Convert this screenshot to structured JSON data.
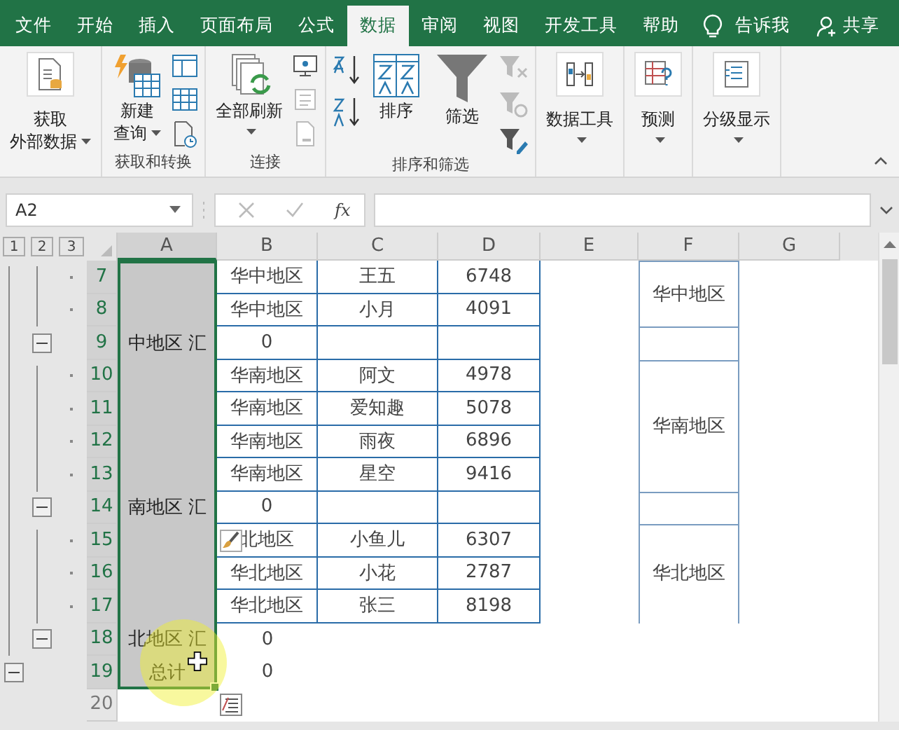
{
  "tabs": [
    {
      "label": "文件",
      "selected": false
    },
    {
      "label": "开始",
      "selected": false
    },
    {
      "label": "插入",
      "selected": false
    },
    {
      "label": "页面布局",
      "selected": false
    },
    {
      "label": "公式",
      "selected": false
    },
    {
      "label": "数据",
      "selected": true
    },
    {
      "label": "审阅",
      "selected": false
    },
    {
      "label": "视图",
      "selected": false
    },
    {
      "label": "开发工具",
      "selected": false
    },
    {
      "label": "帮助",
      "selected": false
    }
  ],
  "tell_me": "告诉我",
  "share": "共享",
  "ribbon": [
    {
      "kind": "get-data",
      "buttons": [
        {
          "lines": [
            "获取",
            "外部数据"
          ],
          "dropdown": true
        }
      ]
    },
    {
      "kind": "query",
      "label": "获取和转换",
      "buttons": [
        {
          "lines": [
            "新建",
            "查询"
          ],
          "dropdown": true
        }
      ]
    },
    {
      "kind": "connections",
      "label": "连接",
      "buttons": [
        {
          "lines": [
            "全部刷新"
          ],
          "dropdown": true
        }
      ]
    },
    {
      "kind": "sort-filter",
      "label": "排序和筛选",
      "buttons": [
        {
          "lines": [
            "排序"
          ],
          "dropdown": false
        },
        {
          "lines": [
            "筛选"
          ],
          "dropdown": false
        }
      ]
    },
    {
      "kind": "data-tools",
      "buttons": [
        {
          "lines": [
            "数据工具"
          ],
          "dropdown": true
        }
      ]
    },
    {
      "kind": "forecast",
      "buttons": [
        {
          "lines": [
            "预测"
          ],
          "dropdown": true
        }
      ]
    },
    {
      "kind": "outline",
      "buttons": [
        {
          "lines": [
            "分级显示"
          ],
          "dropdown": true
        }
      ]
    }
  ],
  "name_box": "A2",
  "fx_label": "fx",
  "outline_levels": [
    "1",
    "2",
    "3"
  ],
  "columns": [
    {
      "label": "A",
      "selected": true
    },
    {
      "label": "B",
      "selected": false
    },
    {
      "label": "C",
      "selected": false
    },
    {
      "label": "D",
      "selected": false
    },
    {
      "label": "E",
      "selected": false
    },
    {
      "label": "F",
      "selected": false
    },
    {
      "label": "G",
      "selected": false
    }
  ],
  "rows": [
    {
      "num": "7",
      "selected": true,
      "kind": "detail",
      "bordered": true,
      "a": "",
      "b": "华中地区",
      "c": "王五",
      "d": "6748",
      "f_block_start": true,
      "f_bordered": true,
      "f": "华中地区"
    },
    {
      "num": "8",
      "selected": true,
      "kind": "detail",
      "bordered": true,
      "a": "",
      "b": "华中地区",
      "c": "小月",
      "d": "4091",
      "f_block_start": false,
      "f_bordered": true
    },
    {
      "num": "9",
      "selected": true,
      "kind": "subtotal",
      "bordered": true,
      "a": "中地区 汇",
      "b": "0",
      "c": "",
      "d": "",
      "f_block_start": true,
      "f_bordered": true
    },
    {
      "num": "10",
      "selected": true,
      "kind": "detail",
      "bordered": true,
      "a": "",
      "b": "华南地区",
      "c": "阿文",
      "d": "4978",
      "f_block_start": true,
      "f_bordered": true,
      "f": "华南地区"
    },
    {
      "num": "11",
      "selected": true,
      "kind": "detail",
      "bordered": true,
      "a": "",
      "b": "华南地区",
      "c": "爱知趣",
      "d": "5078",
      "f_block_start": false,
      "f_bordered": true
    },
    {
      "num": "12",
      "selected": true,
      "kind": "detail",
      "bordered": true,
      "a": "",
      "b": "华南地区",
      "c": "雨夜",
      "d": "6896",
      "f_block_start": false,
      "f_bordered": true
    },
    {
      "num": "13",
      "selected": true,
      "kind": "detail",
      "bordered": true,
      "a": "",
      "b": "华南地区",
      "c": "星空",
      "d": "9416",
      "f_block_start": false,
      "f_bordered": true
    },
    {
      "num": "14",
      "selected": true,
      "kind": "subtotal",
      "bordered": true,
      "a": "南地区 汇",
      "b": "0",
      "c": "",
      "d": "",
      "f_block_start": true,
      "f_bordered": true
    },
    {
      "num": "15",
      "selected": true,
      "kind": "detail",
      "bordered": true,
      "a": "",
      "b": "北地区",
      "flash_fill_tag": true,
      "c": "小鱼儿",
      "d": "6307",
      "f_block_start": true,
      "f_bordered": true,
      "f": "华北地区"
    },
    {
      "num": "16",
      "selected": true,
      "kind": "detail",
      "bordered": true,
      "a": "",
      "b": "华北地区",
      "c": "小花",
      "d": "2787",
      "f_block_start": false,
      "f_bordered": true
    },
    {
      "num": "17",
      "selected": true,
      "kind": "detail",
      "bordered": true,
      "a": "",
      "b": "华北地区",
      "c": "张三",
      "d": "8198",
      "f_block_start": false,
      "f_bordered": true
    },
    {
      "num": "18",
      "selected": true,
      "kind": "subtotal",
      "bordered": false,
      "a": "北地区 汇",
      "b": "0",
      "c": "",
      "d": "",
      "f_block_start": false,
      "f_bordered": false
    },
    {
      "num": "19",
      "selected": true,
      "kind": "total",
      "bordered": false,
      "a": "总计",
      "b": "0",
      "c": "",
      "d": "",
      "f_block_start": false,
      "f_bordered": false
    },
    {
      "num": "20",
      "selected": false,
      "kind": "plain",
      "bordered": false,
      "quick_analysis_tag": true,
      "a": "",
      "b": "",
      "c": "",
      "d": "",
      "f_block_start": false,
      "f_bordered": false
    }
  ]
}
